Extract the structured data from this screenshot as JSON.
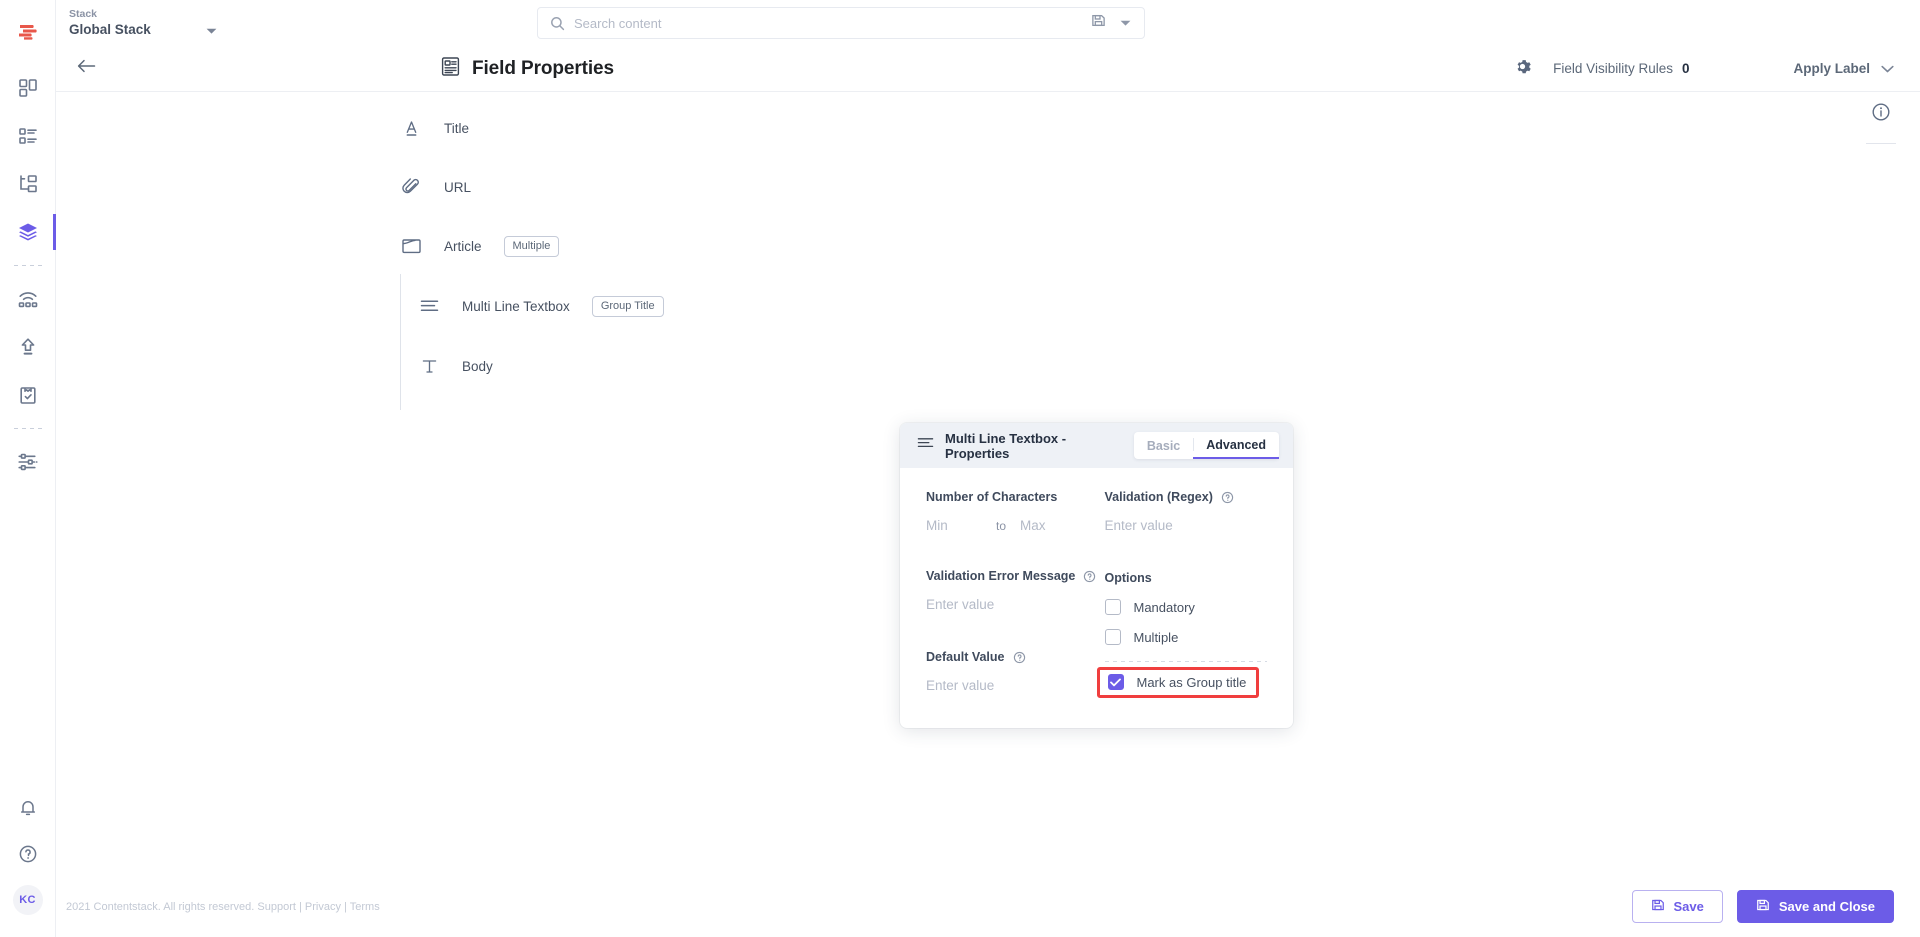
{
  "brand": {
    "accent": "#6c5ce7",
    "highlight": "#f03e3e",
    "logo_icon": "contentstack-logo-icon"
  },
  "topbar": {
    "stack_label": "Stack",
    "stack_name": "Global Stack",
    "stack_caret_icon": "chevron-down-icon",
    "search": {
      "placeholder": "Search content",
      "value": "",
      "icon": "search-icon",
      "save_icon": "save-icon",
      "caret_icon": "chevron-down-icon"
    }
  },
  "rail": {
    "items": [
      {
        "name": "dashboard",
        "icon": "dashboard-grid-icon",
        "active": false
      },
      {
        "name": "entries",
        "icon": "list-entries-icon",
        "active": false
      },
      {
        "name": "content-models",
        "icon": "content-model-icon",
        "active": false
      },
      {
        "name": "stacks",
        "icon": "layers-stack-icon",
        "active": true
      },
      {
        "name": "publish-queue",
        "icon": "webhooks-icon",
        "active": false
      },
      {
        "name": "releases",
        "icon": "upload-arrow-icon",
        "active": false
      },
      {
        "name": "audit-log",
        "icon": "clipboard-check-icon",
        "active": false
      },
      {
        "name": "settings",
        "icon": "sliders-settings-icon",
        "active": false
      }
    ],
    "bottom": [
      {
        "name": "notifications",
        "icon": "bell-icon"
      },
      {
        "name": "help",
        "icon": "question-circle-icon"
      }
    ],
    "avatar_initials": "KC"
  },
  "pagehead": {
    "back_icon": "arrow-left-icon",
    "title": "Field Properties",
    "title_icon": "field-properties-icon",
    "gear_icon": "gear-icon",
    "field_visibility_rules_label": "Field Visibility Rules",
    "field_visibility_rules_count": "0",
    "apply_label_text": "Apply Label",
    "apply_label_caret_icon": "chevron-down-icon"
  },
  "canvas": {
    "info_icon": "info-circle-icon",
    "fields": [
      {
        "name": "Title",
        "icon": "single-line-text-icon",
        "tag": null
      },
      {
        "name": "URL",
        "icon": "link-url-icon",
        "tag": null
      },
      {
        "name": "Article",
        "icon": "group-folder-icon",
        "tag": "Multiple"
      }
    ],
    "children": [
      {
        "name": "Multi Line Textbox",
        "icon": "multi-line-text-icon",
        "tag": "Group Title"
      },
      {
        "name": "Body",
        "icon": "rich-text-icon",
        "tag": null
      }
    ]
  },
  "panel": {
    "header_icon": "multi-line-text-icon",
    "title": "Multi Line Textbox - Properties",
    "tabs": [
      {
        "label": "Basic",
        "active": false
      },
      {
        "label": "Advanced",
        "active": true
      }
    ],
    "number_of_characters": {
      "label": "Number of Characters",
      "min_placeholder": "Min",
      "min_value": "",
      "separator": "to",
      "max_placeholder": "Max",
      "max_value": ""
    },
    "validation_error_message": {
      "label": "Validation Error Message",
      "help_icon": "question-circle-icon",
      "placeholder": "Enter value",
      "value": ""
    },
    "default_value": {
      "label": "Default Value",
      "help_icon": "question-circle-icon",
      "placeholder": "Enter value",
      "value": ""
    },
    "validation_regex": {
      "label": "Validation (Regex)",
      "help_icon": "question-circle-icon",
      "placeholder": "Enter value",
      "value": ""
    },
    "options": {
      "label": "Options",
      "items": [
        {
          "label": "Mandatory",
          "checked": false,
          "highlighted": false
        },
        {
          "label": "Multiple",
          "checked": false,
          "highlighted": false
        },
        {
          "label": "Mark as Group title",
          "checked": true,
          "highlighted": true
        }
      ]
    }
  },
  "footer": {
    "copyright": "2021 Contentstack. All rights reserved.",
    "links": [
      "Support",
      "Privacy",
      "Terms"
    ],
    "separator": "|",
    "save_label": "Save",
    "save_icon": "save-disk-icon",
    "save_close_label": "Save and Close",
    "save_close_icon": "save-disk-icon"
  }
}
